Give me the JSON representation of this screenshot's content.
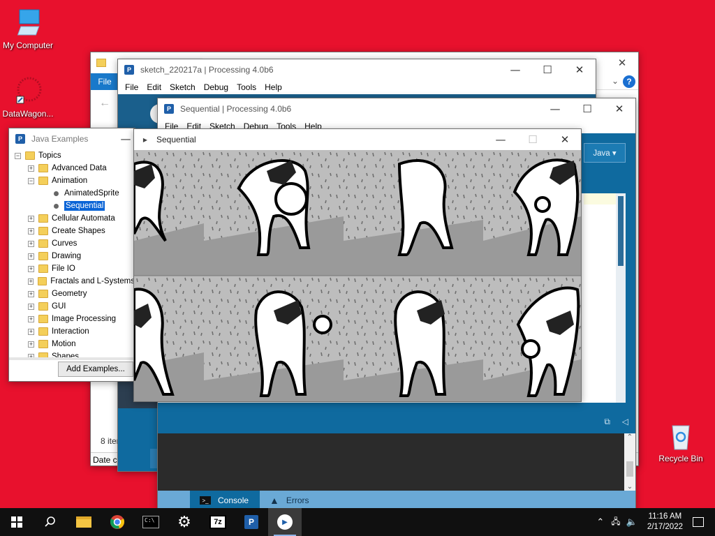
{
  "desktop": {
    "icons": [
      {
        "label": "My Computer"
      },
      {
        "label": "DataWagon..."
      },
      {
        "label": "Recycle Bin"
      }
    ]
  },
  "explorer": {
    "file_tab": "File",
    "status_items": "8 item",
    "column_date": "Date cr"
  },
  "sketch_window": {
    "title": "sketch_220217a | Processing 4.0b6",
    "menu": [
      "File",
      "Edit",
      "Sketch",
      "Debug",
      "Tools",
      "Help"
    ]
  },
  "sequential_ide": {
    "title": "Sequential | Processing 4.0b6",
    "menu": [
      "File",
      "Edit",
      "Sketch",
      "Debug",
      "Tools",
      "Help"
    ],
    "mode_button": "Java ▾",
    "tabs": {
      "console": "Console",
      "errors": "Errors"
    }
  },
  "examples_window": {
    "title": "Java Examples",
    "root": "Topics",
    "items": [
      {
        "label": "Advanced Data",
        "expanded": false
      },
      {
        "label": "Animation",
        "expanded": true,
        "children": [
          {
            "label": "AnimatedSprite"
          },
          {
            "label": "Sequential",
            "selected": true
          }
        ]
      },
      {
        "label": "Cellular Automata",
        "expanded": false
      },
      {
        "label": "Create Shapes",
        "expanded": false
      },
      {
        "label": "Curves",
        "expanded": false
      },
      {
        "label": "Drawing",
        "expanded": false
      },
      {
        "label": "File IO",
        "expanded": false
      },
      {
        "label": "Fractals and L-Systems",
        "expanded": false
      },
      {
        "label": "Geometry",
        "expanded": false
      },
      {
        "label": "GUI",
        "expanded": false
      },
      {
        "label": "Image Processing",
        "expanded": false
      },
      {
        "label": "Interaction",
        "expanded": false
      },
      {
        "label": "Motion",
        "expanded": false
      },
      {
        "label": "Shapes",
        "expanded": false
      }
    ],
    "add_button": "Add Examples..."
  },
  "sketch_output": {
    "title": "Sequential"
  },
  "taskbar": {
    "clock_time": "11:16 AM",
    "clock_date": "2/17/2022"
  },
  "colors": {
    "desktop": "#e8112d",
    "processing_blue": "#0f6a9f",
    "selection": "#0a64d6"
  }
}
